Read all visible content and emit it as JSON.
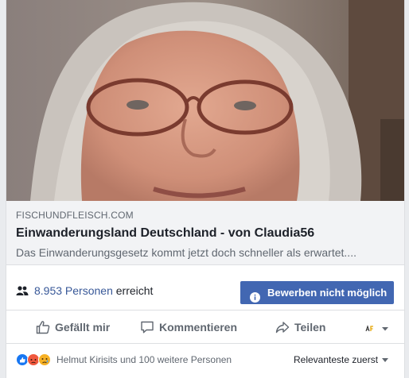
{
  "link_preview": {
    "domain": "FISCHUNDFLEISCH.COM",
    "title": "Einwanderungsland Deutschland - von Claudia56",
    "description": "Das Einwanderungsgesetz kommt jetzt doch schneller als erwartet...."
  },
  "reach": {
    "count": "8.953 Personen",
    "suffix": " erreicht"
  },
  "boost_button": {
    "label": "Bewerben nicht möglich"
  },
  "actions": {
    "like": "Gefällt mir",
    "comment": "Kommentieren",
    "share": "Teilen"
  },
  "summary": {
    "text": "Helmut Kirisits und 100 weitere Personen",
    "sort_label": "Relevanteste zuerst"
  },
  "colors": {
    "link_blue": "#385898",
    "button_blue": "#4267b2",
    "text_gray": "#606770"
  },
  "icons": {
    "reach": "people-icon",
    "boost": "info-icon",
    "like": "thumbs-up-icon",
    "comment": "speech-bubble-icon",
    "share": "share-arrow-icon"
  }
}
